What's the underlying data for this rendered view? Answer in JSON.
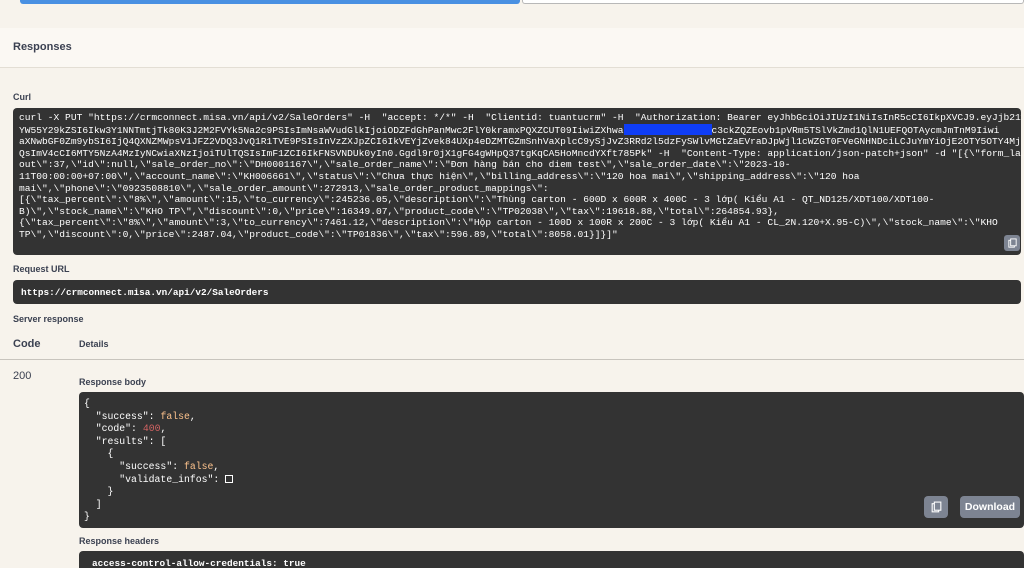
{
  "responses": {
    "title": "Responses"
  },
  "curl": {
    "label": "Curl",
    "lines": [
      "curl -X PUT \"https://crmconnect.misa.vn/api/v2/SaleOrders\" -H  \"accept: */*\" -H  \"Clientid: tuantucrm\" -H  \"Authorization: Bearer eyJhbGciOiJIUzI1NiIsInR5cCI6IkpXVCJ9.eyJjb21w-",
      "YW55Y29kZSI6Ikw3Y1NNTmtjTk80K3J2M2FVYk5Na2c9PSIsImNsaWVudGlkIjoiODZFdGhPanMwc2FlY0kramxPQXZCUT09IiwiZXhwa",
      "aXNwbGF0Zm9ybSI6IjQ4QXNZMWpsV1JFZ2VDQ3JvQ1R1TVE9PSIsInVzZXJpZCI6IkVEYjZvek84UXp4eDZMTGZmSnhVaXplcC9ySjJvZ3RRd2l5dzFySWlvMGtZaEVraDJpWjl1cWZGT0FVeGNHNDciLCJuYmYiOjE2OTY5OTY4Mj-",
      "QsImV4cCI6MTY5NzA4MzIyNCwiaXNzIjoiTUlTQSIsImF1ZCI6IkFNSVNDUk0yIn0.Ggdl9r0jX1gFG4gWHpQ37tgKqCA5HoMncdYXft785Pk\" -H  \"Content-Type: application/json-patch+json\" -d \"[{\\\"form_lay-",
      "out\\\":37,\\\"id\\\":null,\\\"sale_order_no\\\":\\\"DH0001167\\\",\\\"sale_order_name\\\":\\\"Đơn hàng bán cho diem test\\\",\\\"sale_order_date\\\":\\\"2023-10-",
      "11T00:00:00+07:00\\\",\\\"account_name\\\":\\\"KH006661\\\",\\\"status\\\":\\\"Chưa thực hiện\\\",\\\"billing_address\\\":\\\"120 hoa mai\\\",\\\"shipping_address\\\":\\\"120 hoa",
      "mai\\\",\\\"phone\\\":\\\"0923508810\\\",\\\"sale_order_amount\\\":272913,\\\"sale_order_product_mappings\\\":",
      "[{\\\"tax_percent\\\":\\\"8%\\\",\\\"amount\\\":15,\\\"to_currency\\\":245236.05,\\\"description\\\":\\\"Thùng carton - 600D x 600R x 400C - 3 lớp( Kiểu A1 - QT_ND125/XDT100/XDT100-",
      "B)\\\",\\\"stock_name\\\":\\\"KHO TP\\\",\\\"discount\\\":0,\\\"price\\\":16349.07,\\\"product_code\\\":\\\"TP02038\\\",\\\"tax\\\":19618.88,\\\"total\\\":264854.93},",
      "{\\\"tax_percent\\\":\\\"8%\\\",\\\"amount\\\":3,\\\"to_currency\\\":7461.12,\\\"description\\\":\\\"Hộp carton - 100D x 100R x 200C - 3 lớp( Kiểu A1 - CL_2N.120+X.95-C)\\\",\\\"stock_name\\\":\\\"KHO",
      "TP\\\",\\\"discount\\\":0,\\\"price\\\":2487.04,\\\"product_code\\\":\\\"TP01836\\\",\\\"tax\\\":596.89,\\\"total\\\":8058.01}]}]\""
    ],
    "line1_tail": "c3ckZQZEovb1pVRm5TSlVkZmd1QlN1UEFQOTAycmJmTnM9Iiwi"
  },
  "request_url": {
    "label": "Request URL",
    "value": "https://crmconnect.misa.vn/api/v2/SaleOrders"
  },
  "server_response": {
    "label": "Server response",
    "code_header": "Code",
    "details_header": "Details",
    "code": "200",
    "body_label": "Response body",
    "body": {
      "open": "{",
      "success_key": "\"success\": ",
      "success_val": "false",
      "code_key": "\"code\": ",
      "code_val": "400",
      "results_key": "\"results\": [",
      "item_open": "{",
      "item_success_key": "\"success\": ",
      "item_success_val": "false",
      "validate_key": "\"validate_infos\": ",
      "item_close": "}",
      "arr_close": "]",
      "close": "}"
    },
    "download_label": "Download",
    "headers_label": "Response headers",
    "headers_first": "access-control-allow-credentials: true"
  },
  "icons": {
    "copy": "clipboard-icon"
  }
}
